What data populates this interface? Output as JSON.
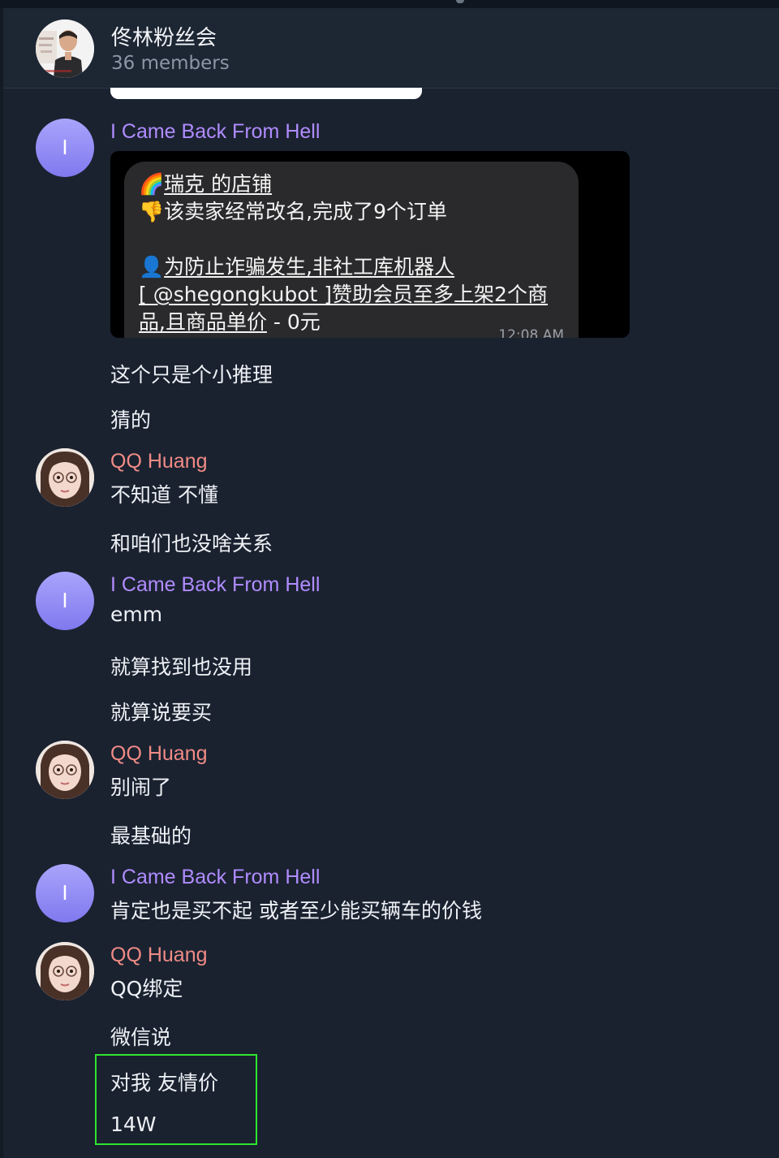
{
  "header": {
    "title": "佟林粉丝会",
    "subtitle": "36 members"
  },
  "messages": {
    "group1": {
      "sender": "I Came Back From Hell",
      "avatar_letter": "I",
      "media": {
        "line1_emoji": "🌈",
        "line1_text": "瑞克 的店铺",
        "line2_emoji": "👎",
        "line2_text": "该卖家经常改名,完成了9个订单",
        "line3_emoji": "👤",
        "line3_text": "为防止诈骗发生,非社工库机器人",
        "line4_text": "[ @shegongkubot ]赞助会员至多上架2个商",
        "line5_text": "品,且商品单价",
        "line5_suffix": " - 0元",
        "time": "12:08 AM"
      },
      "text1": "这个只是个小推理",
      "text2": "猜的"
    },
    "group2": {
      "sender": "QQ Huang",
      "text1": "不知道 不懂",
      "text2": "和咱们也没啥关系"
    },
    "group3": {
      "sender": "I Came Back From Hell",
      "avatar_letter": "I",
      "text1": "emm",
      "text2": "就算找到也没用",
      "text3": "就算说要买"
    },
    "group4": {
      "sender": "QQ Huang",
      "text1": "别闹了",
      "text2": "最基础的"
    },
    "group5": {
      "sender": "I Came Back From Hell",
      "avatar_letter": "I",
      "text1": "肯定也是买不起 或者至少能买辆车的价钱"
    },
    "group6": {
      "sender": "QQ Huang",
      "text1": "QQ绑定",
      "text2": "微信说",
      "text3": "对我 友情价",
      "text4": "14W"
    }
  },
  "colors": {
    "background": "#1a2230",
    "sender_purple": "#b08cff",
    "sender_pink": "#f08b85",
    "highlight_box": "#2ee62e"
  }
}
